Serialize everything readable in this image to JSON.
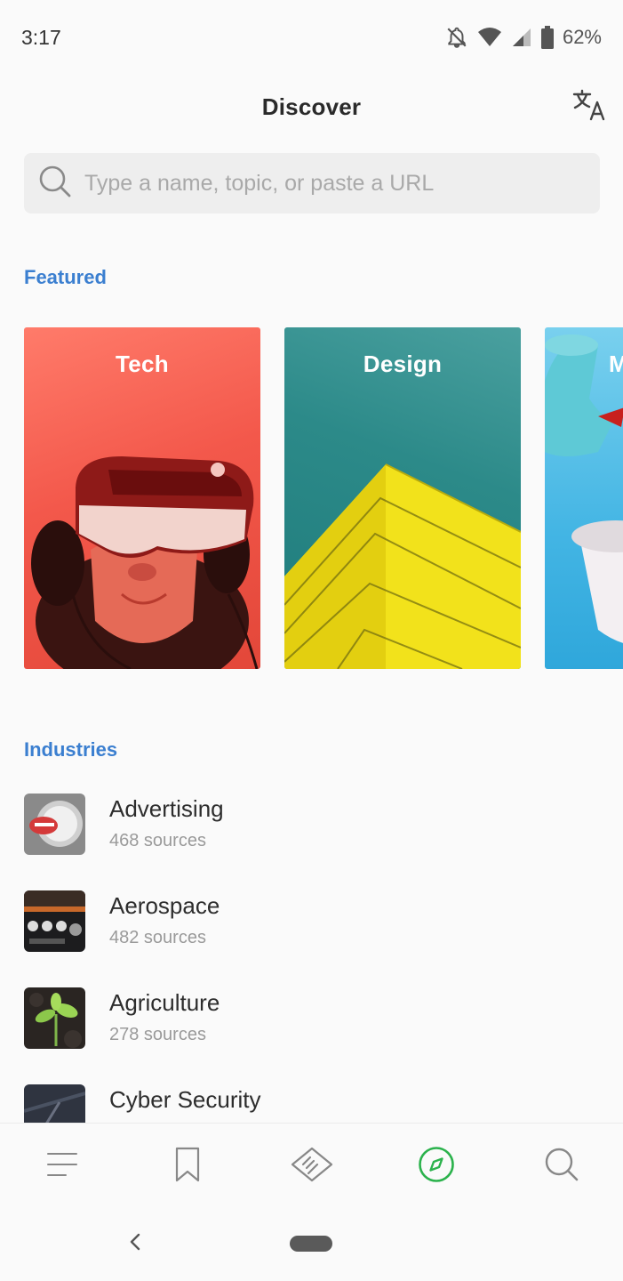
{
  "status_bar": {
    "time": "3:17",
    "battery": "62%"
  },
  "header": {
    "title": "Discover"
  },
  "search": {
    "placeholder": "Type a name, topic, or paste a URL"
  },
  "featured": {
    "title": "Featured",
    "cards": [
      {
        "label": "Tech"
      },
      {
        "label": "Design"
      },
      {
        "label": "M"
      }
    ]
  },
  "industries": {
    "title": "Industries",
    "items": [
      {
        "name": "Advertising",
        "count": "468 sources"
      },
      {
        "name": "Aerospace",
        "count": "482 sources"
      },
      {
        "name": "Agriculture",
        "count": "278 sources"
      },
      {
        "name": "Cyber Security",
        "count": ""
      }
    ]
  },
  "bottom_nav": {
    "items": [
      "menu-icon",
      "bookmark-icon",
      "feedly-icon",
      "compass-icon",
      "search-icon"
    ],
    "active": "compass-icon",
    "active_color": "#2bb24c"
  },
  "colors": {
    "accent": "#3b7fd0",
    "active": "#2bb24c"
  }
}
